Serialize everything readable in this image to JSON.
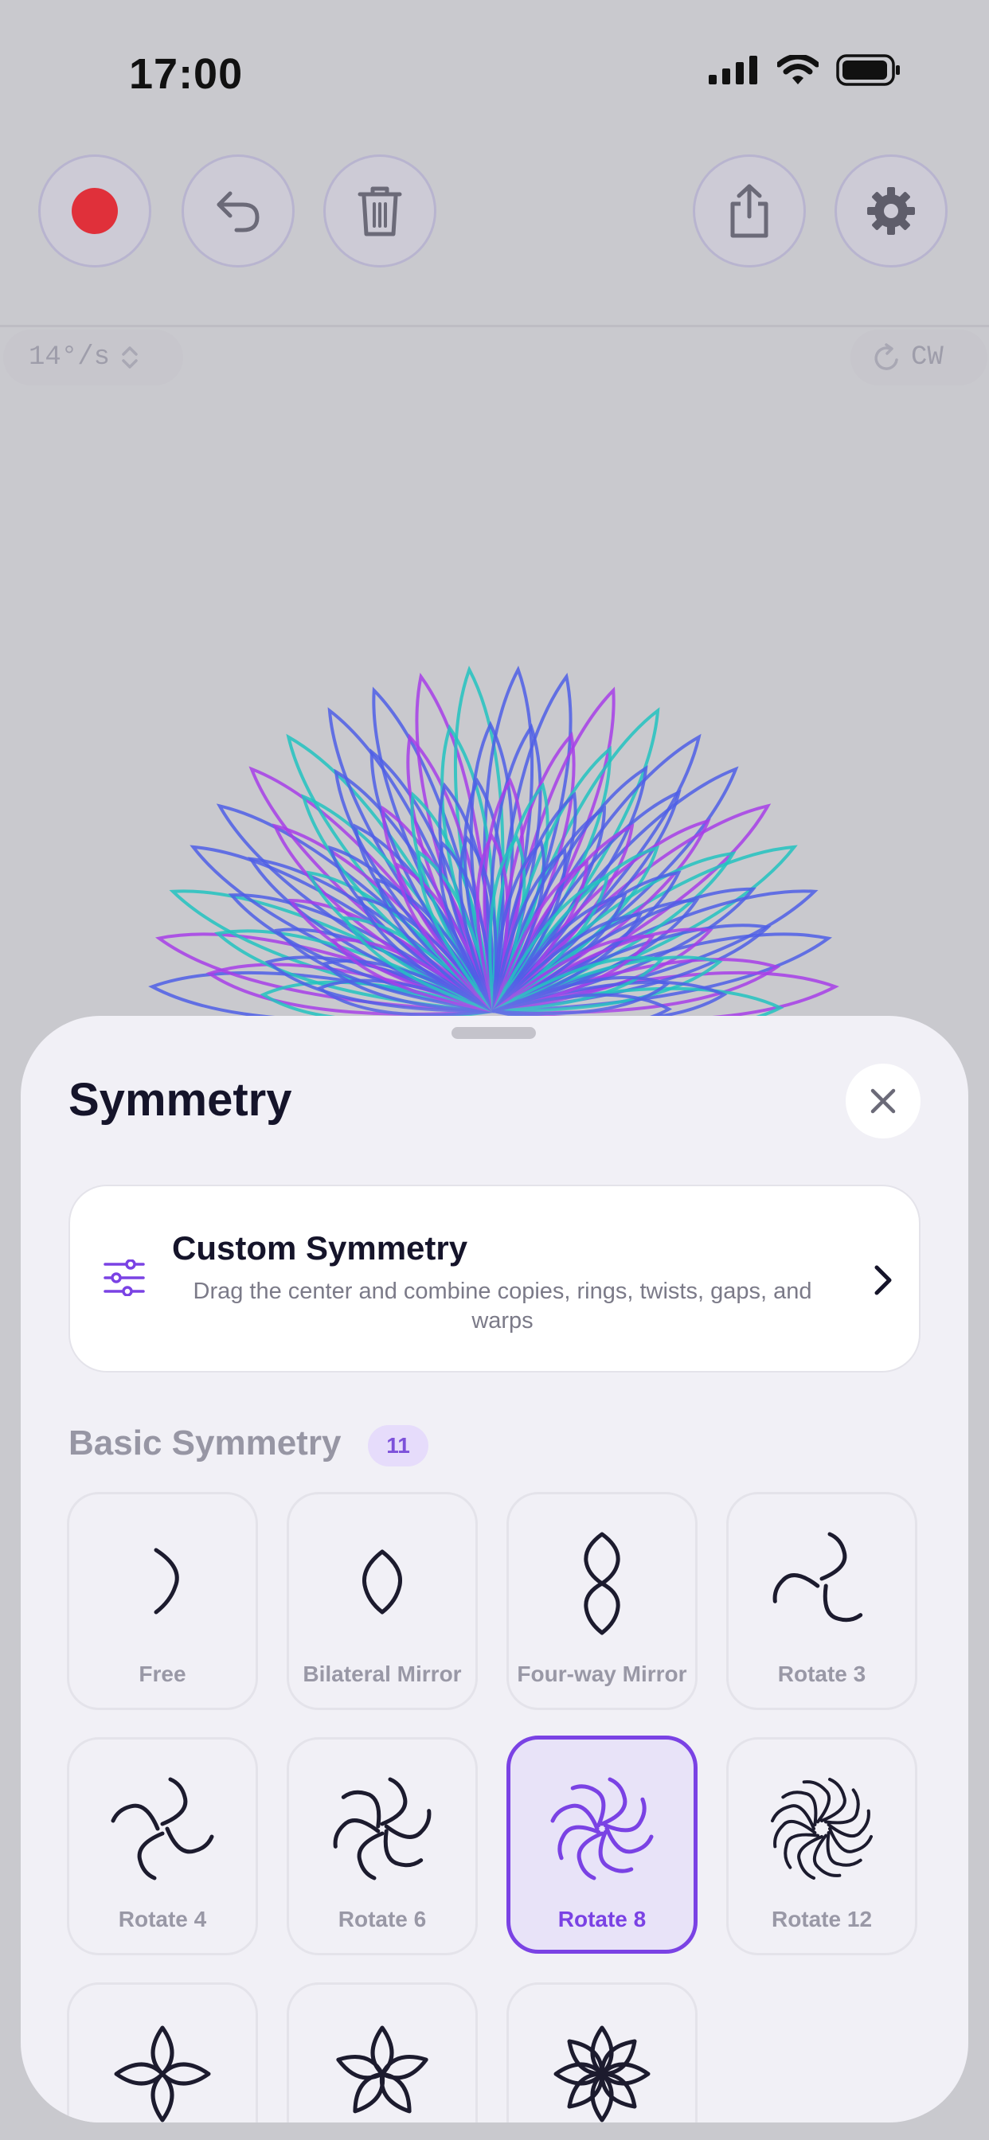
{
  "status_bar": {
    "time": "17:00"
  },
  "toolbar": {
    "record": "record-button",
    "undo": "undo-button",
    "delete": "trash-button",
    "share": "share-button",
    "settings": "settings-button"
  },
  "canvas": {
    "speed": "14°/s",
    "direction": "CW"
  },
  "sheet": {
    "title": "Symmetry",
    "custom": {
      "title": "Custom Symmetry",
      "description": "Drag the center and combine copies, rings, twists, gaps, and warps"
    },
    "section": {
      "title": "Basic Symmetry",
      "count": "11"
    },
    "modes": [
      {
        "label": "Free",
        "icon": "free-stroke-icon"
      },
      {
        "label": "Bilateral Mirror",
        "icon": "bilateral-mirror-icon"
      },
      {
        "label": "Four-way Mirror",
        "icon": "four-way-mirror-icon"
      },
      {
        "label": "Rotate 3",
        "icon": "rotate-3-icon"
      },
      {
        "label": "Rotate 4",
        "icon": "rotate-4-icon"
      },
      {
        "label": "Rotate 6",
        "icon": "rotate-6-icon"
      },
      {
        "label": "Rotate 8",
        "icon": "rotate-8-icon",
        "selected": true
      },
      {
        "label": "Rotate 12",
        "icon": "rotate-12-icon"
      }
    ]
  },
  "colors": {
    "accent": "#7a42e4",
    "record": "#e0303a",
    "art_purple": "#a73ee8",
    "art_blue": "#4f5fe6",
    "art_teal": "#22c3c0"
  }
}
